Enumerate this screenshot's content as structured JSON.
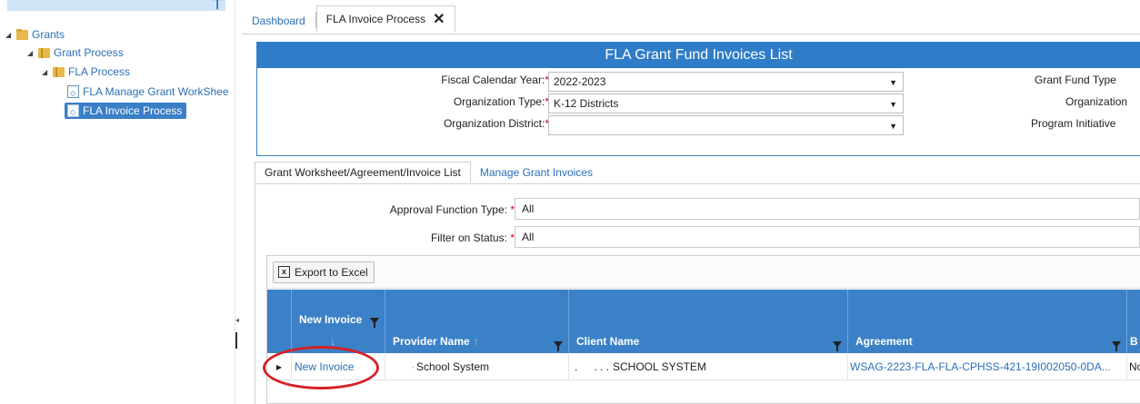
{
  "tree": {
    "root": "Grants",
    "level1": "Grant Process",
    "level2": "FLA Process",
    "items": [
      "FLA Manage Grant WorkShee",
      "FLA Invoice Process"
    ]
  },
  "tabs": [
    {
      "label": "Dashboard"
    },
    {
      "label": "FLA Invoice Process",
      "close": "✕"
    }
  ],
  "header": {
    "title": "FLA Grant Fund Invoices List",
    "fields": [
      {
        "label": "Fiscal Calendar Year:",
        "value": "2022-2023"
      },
      {
        "label": "Organization Type:",
        "value": "K-12 Districts"
      },
      {
        "label": "Organization District:",
        "value": ""
      }
    ],
    "right_labels": [
      "Grant Fund Type",
      "Organization",
      "Program Initiative"
    ]
  },
  "inner_tabs": [
    "Grant Worksheet/Agreement/Invoice List",
    "Manage Grant Invoices"
  ],
  "filters": {
    "approval_label": "Approval Function Type:",
    "approval_value": "All",
    "status_label": "Filter on Status:",
    "status_value": "All"
  },
  "grid": {
    "export_label": "Export to Excel",
    "columns": [
      "New Invoice",
      "Provider Name",
      "Client Name",
      "Agreement",
      "B P"
    ],
    "rows": [
      {
        "new_invoice": "New Invoice",
        "provider": "School System",
        "client": "SCHOOL SYSTEM",
        "agreement": "WSAG-2223-FLA-FLA-CPHSS-421-19I002050-0DA...",
        "extra": "No"
      }
    ]
  },
  "colors": {
    "accent": "#2f7cc9",
    "link": "#2a6fb8",
    "highlight": "#d62027"
  }
}
